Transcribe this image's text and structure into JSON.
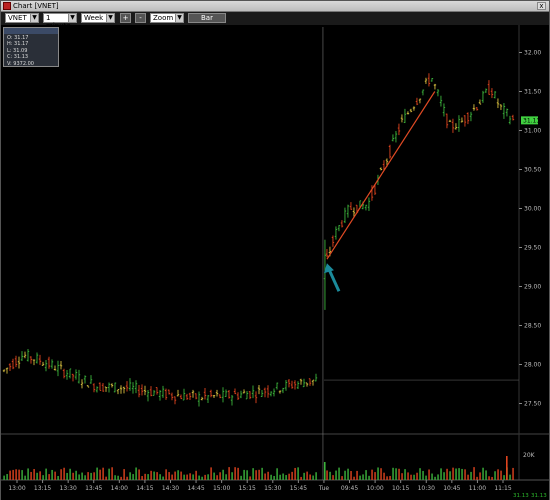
{
  "window": {
    "title": "Chart [VNET]",
    "close_glyph": "x"
  },
  "toolbar": {
    "symbol": "VNET",
    "interval": "1 minute",
    "range": "Week",
    "zoom_in": "+",
    "zoom_out": "-",
    "zoom": "Zoom",
    "style_button": "Bar"
  },
  "ohlc_box": {
    "header": "",
    "open": "O: 31.17",
    "high": "H: 31.17",
    "low": "L: 31.09",
    "close": "C: 31.13",
    "volume": "V: 9372.00"
  },
  "chart_data": {
    "type": "ohlc",
    "price_ticks": [
      "32.00",
      "31.50",
      "31.00",
      "30.50",
      "30.00",
      "29.50",
      "29.00",
      "28.50",
      "28.00",
      "27.50"
    ],
    "price_range": [
      27.25,
      32.25
    ],
    "volume_tick": "20K",
    "last_price": "31.13",
    "time_labels": [
      "13:00",
      "13:15",
      "13:30",
      "13:45",
      "14:00",
      "14:15",
      "14:30",
      "14:45",
      "15:00",
      "15:15",
      "15:30",
      "15:45",
      "Tue",
      "09:45",
      "10:00",
      "10:15",
      "10:30",
      "10:45",
      "11:00",
      "11:15"
    ],
    "footer_values": [
      "31.13",
      "31.13"
    ],
    "prev_close": 27.8,
    "trendline": {
      "from": {
        "time": "09:30",
        "price": 29.35
      },
      "to": {
        "time": "10:35",
        "price": 31.5
      }
    },
    "annotation": "arrow",
    "colors": {
      "up": "#3cb43c",
      "down": "#e0441e",
      "neutral": "#d8c040",
      "trendline": "#e04a24",
      "arrow": "#1b8a9a",
      "last_price_tag": "#40d040"
    }
  }
}
